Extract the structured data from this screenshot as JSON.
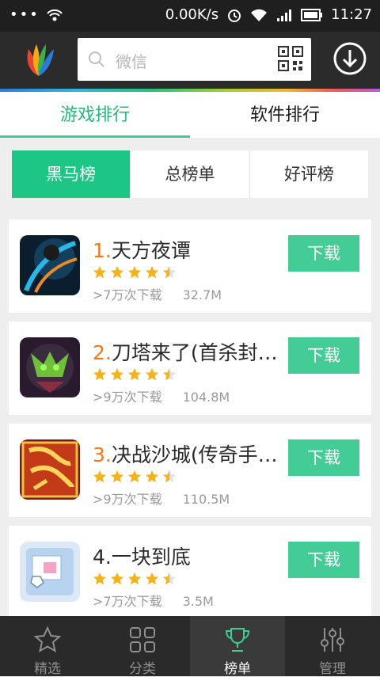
{
  "status_bar": {
    "network_speed": "0.00K/s",
    "time": "11:27"
  },
  "search": {
    "placeholder": "微信"
  },
  "tabs": [
    {
      "label": "游戏排行"
    },
    {
      "label": "软件排行"
    }
  ],
  "segments": [
    {
      "label": "黑马榜"
    },
    {
      "label": "总榜单"
    },
    {
      "label": "好评榜"
    }
  ],
  "apps": [
    {
      "rank": "1.",
      "name": "天方夜谭",
      "rating": 4.5,
      "downloads": ">7万次下载",
      "size": "32.7M",
      "button": "下载"
    },
    {
      "rank": "2.",
      "name": "刀塔来了(首杀封…",
      "rating": 4.5,
      "downloads": ">9万次下载",
      "size": "104.8M",
      "button": "下载"
    },
    {
      "rank": "3.",
      "name": "决战沙城(传奇手…",
      "rating": 4.5,
      "downloads": ">9万次下载",
      "size": "110.5M",
      "button": "下载"
    },
    {
      "rank": "4.",
      "name": "一块到底",
      "rating": 4.5,
      "downloads": ">7万次下载",
      "size": "3.5M",
      "button": "下载"
    }
  ],
  "bottom_nav": [
    {
      "label": "精选"
    },
    {
      "label": "分类"
    },
    {
      "label": "榜单"
    },
    {
      "label": "管理"
    }
  ],
  "colors": {
    "accent": "#1ec685",
    "button": "#44cc96",
    "rank_orange": "#f07a1a",
    "star": "#f5b317"
  }
}
